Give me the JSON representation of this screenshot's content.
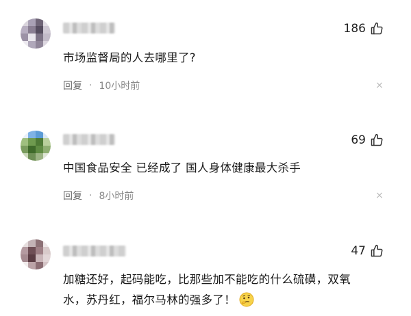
{
  "comments": [
    {
      "likes": "186",
      "text": "市场监督局的人去哪里了?",
      "reply_label": "回复",
      "separator": "·",
      "time": "10小时前",
      "avatar_colors": [
        "#d9d4dc",
        "#a9a1b5",
        "#6f6577",
        "#e3dfe6",
        "#b7aec1",
        "#8a7f93",
        "#564d60",
        "#cfc9d4",
        "#9c92a6",
        "#e9e6ec",
        "#7d7386",
        "#c2bbc8",
        "#ece9ef",
        "#b0a8ba",
        "#908699",
        "#dcd7e0"
      ]
    },
    {
      "likes": "69",
      "text": "中国食品安全 已经成了 国人身体健康最大杀手",
      "reply_label": "回复",
      "separator": "·",
      "time": "8小时前",
      "avatar_colors": [
        "#e8f0fa",
        "#7fb2e6",
        "#5c9bd6",
        "#dbe8f5",
        "#9fbf7f",
        "#6f9a4f",
        "#4e7a35",
        "#b9cf9c",
        "#7a9c5e",
        "#3f6a2a",
        "#5f8b43",
        "#8fae72",
        "#c9d7b8",
        "#6e8f55",
        "#9cb384",
        "#dfe6d6"
      ]
    },
    {
      "likes": "47",
      "text_line1": "加糖还好，起码能吃，比那些加不能吃的什么硫磺，双氧",
      "text_line2": "水，苏丹红，福尔马林的强多了！",
      "emoji": "thinking-face-icon",
      "avatar_colors": [
        "#e6dede",
        "#c3b3b6",
        "#8d7176",
        "#efe8e9",
        "#b49aa0",
        "#6e4e55",
        "#9e7f85",
        "#d8caca",
        "#a58a90",
        "#5a3c43",
        "#c9b5b8",
        "#e2d6d7",
        "#f1ecec",
        "#bba3a7",
        "#8b6d73",
        "#d4c4c6"
      ]
    }
  ],
  "icons": {
    "like": "thumbs-up-icon",
    "close": "close-icon",
    "close_glyph": "×"
  }
}
